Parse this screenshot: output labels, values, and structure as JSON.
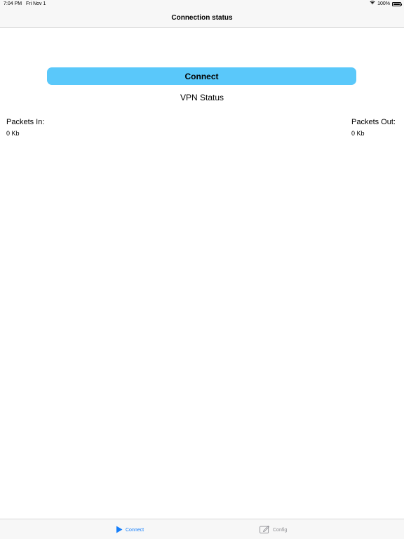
{
  "status_bar": {
    "time": "7:04 PM",
    "date": "Fri Nov 1",
    "battery": "100%",
    "icons": [
      "wifi-icon",
      "battery-icon"
    ]
  },
  "nav": {
    "title": "Connection status"
  },
  "main": {
    "connect_button_label": "Connect",
    "vpn_status": "VPN Status",
    "packets_in_label": "Packets In:",
    "packets_in_value": "0 Kb",
    "packets_out_label": "Packets Out:",
    "packets_out_value": "0 Kb"
  },
  "tab_bar": {
    "tabs": [
      {
        "label": "Connect",
        "icon": "play-icon",
        "selected": true
      },
      {
        "label": "Config",
        "icon": "edit-icon",
        "selected": false
      }
    ]
  },
  "colors": {
    "button": "#5ac8fa",
    "tab_active": "#147efb",
    "tab_inactive": "#8e8e93",
    "bar_background": "#f7f7f7"
  }
}
